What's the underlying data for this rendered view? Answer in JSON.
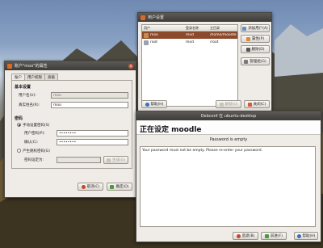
{
  "colors": {
    "accent": "#d96a2a",
    "selection": "#8c4a2c",
    "titlebar": "#3d3c38"
  },
  "users_window": {
    "title": "用户设置",
    "columns": [
      "用户",
      "登录名称",
      "主目录"
    ],
    "rows": [
      {
        "name": "moo",
        "login": "mod",
        "home": "/home/moodle"
      },
      {
        "name": "root",
        "login": "mod",
        "home": "/root"
      }
    ],
    "side_buttons": [
      "添加用户(A)",
      "属性(P)",
      "删除(D)",
      "管理组(G)"
    ],
    "help_label": "帮助(H)",
    "unlock_label": "解锁(U)",
    "close_label": "关闭(C)"
  },
  "props_window": {
    "title": "账户\"moo\"的属性",
    "tabs": [
      "账户",
      "用户权限",
      "高级"
    ],
    "basic_section": "基本设置",
    "username_label": "用户名(U):",
    "username_value": "moo",
    "realname_label": "真实姓名(R):",
    "realname_value": "moo",
    "password_section": "密码",
    "manual_option": "手动设置密码(S)",
    "password_label": "用户密码(P):",
    "password_value": "••••••••",
    "confirm_label": "确认(C):",
    "confirm_value": "••••••••",
    "random_option": "产生随机密码(G)",
    "generated_label": "密码设定为:",
    "generate_button": "生成(G)",
    "cancel_label": "取消(C)",
    "ok_label": "确定(O)"
  },
  "debconf_window": {
    "title": "Debconf 在 ubuntu-desktop",
    "heading": "正在设定 moodle",
    "subheading": "Password is empty",
    "message": "Your password must not be empty. Please re-enter your password.",
    "back_label": "后退(B)",
    "forward_label": "前进(F)"
  }
}
